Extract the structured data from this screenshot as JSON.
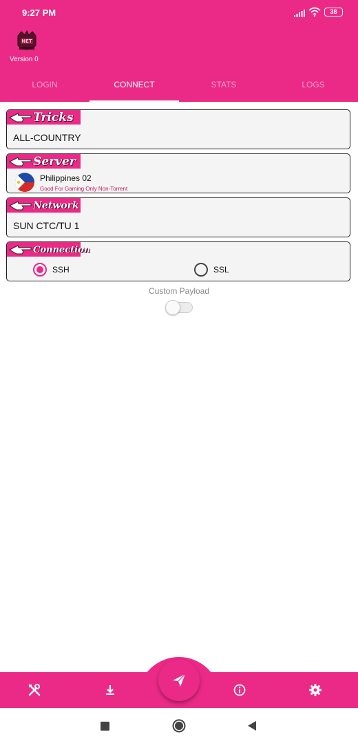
{
  "status_bar": {
    "time": "9:27 PM",
    "battery": "38"
  },
  "header": {
    "version": "Version 0"
  },
  "tabs": [
    {
      "label": "LOGIN",
      "active": false
    },
    {
      "label": "CONNECT",
      "active": true
    },
    {
      "label": "STATS",
      "active": false
    },
    {
      "label": "LOGS",
      "active": false
    }
  ],
  "tricks": {
    "title": "Tricks",
    "value": "ALL-COUNTRY"
  },
  "server": {
    "title": "Server",
    "name": "Philippines 02",
    "description": "Good For Gaming Only Non-Torrent",
    "flag": "philippines-flag"
  },
  "network": {
    "title": "Network",
    "value": "SUN CTC/TU 1"
  },
  "connection": {
    "title": "Connection",
    "options": [
      {
        "label": "SSH",
        "checked": true
      },
      {
        "label": "SSL",
        "checked": false
      }
    ]
  },
  "custom_payload": {
    "label": "Custom Payload",
    "enabled": false
  },
  "bottom_nav": {
    "icons": [
      "tools-icon",
      "download-icon",
      "send-icon",
      "info-icon",
      "settings-icon"
    ]
  },
  "colors": {
    "primary": "#ea2a86",
    "accent_text": "#c2185b"
  }
}
